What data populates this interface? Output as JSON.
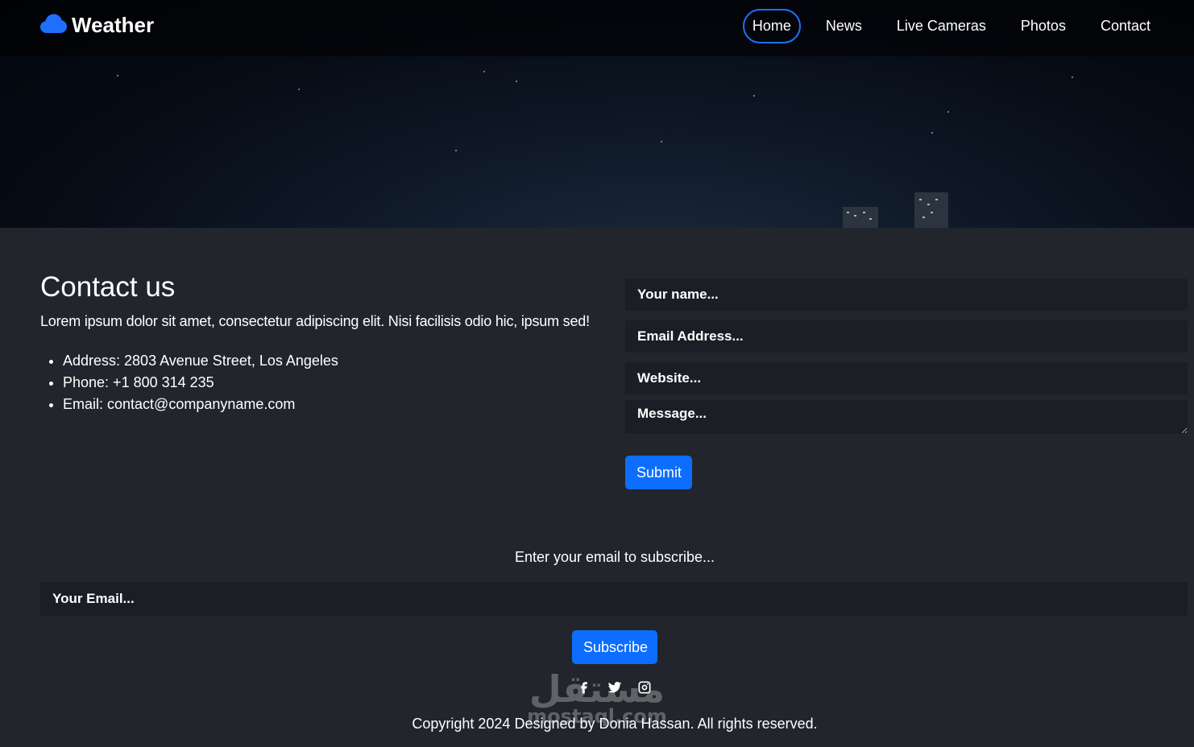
{
  "brand": {
    "name": "Weather",
    "icon": "cloud-icon"
  },
  "nav": {
    "items": [
      {
        "label": "Home",
        "active": true
      },
      {
        "label": "News",
        "active": false
      },
      {
        "label": "Live Cameras",
        "active": false
      },
      {
        "label": "Photos",
        "active": false
      },
      {
        "label": "Contact",
        "active": false
      }
    ]
  },
  "contact": {
    "title": "Contact us",
    "description": "Lorem ipsum dolor sit amet, consectetur adipiscing elit. Nisi facilisis odio hic, ipsum sed!",
    "details": [
      "Address: 2803 Avenue Street, Los Angeles",
      "Phone: +1 800 314 235",
      "Email: contact@companyname.com"
    ]
  },
  "form": {
    "name_placeholder": "Your name...",
    "email_placeholder": "Email Address...",
    "website_placeholder": "Website...",
    "message_placeholder": "Message...",
    "submit_label": "Submit"
  },
  "subscribe": {
    "label": "Enter your email to subscribe...",
    "email_placeholder": "Your Email...",
    "button_label": "Subscribe"
  },
  "social": {
    "icons": [
      "facebook-icon",
      "twitter-icon",
      "instagram-icon"
    ]
  },
  "footer": {
    "copyright": "Copyright 2024 Designed by Donia Hassan. All rights reserved."
  },
  "watermark": {
    "arabic": "مستقل",
    "latin": "mostaql.com"
  },
  "colors": {
    "accent": "#0d6efd",
    "background": "#22252b",
    "input_bg": "#1b1e24",
    "active_border": "#1f6fff"
  }
}
